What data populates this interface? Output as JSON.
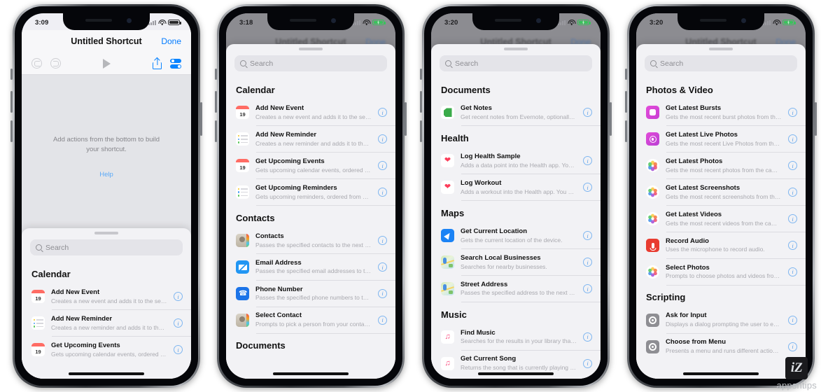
{
  "watermark": {
    "logo": "iZ",
    "text": "appsntips"
  },
  "phones": [
    {
      "id": "phone-editor",
      "status": {
        "time": "3:09",
        "battery_charging": false
      },
      "nav": {
        "title": "Untitled Shortcut",
        "done": "Done"
      },
      "toolbar": {
        "undo": "undo-icon",
        "redo": "redo-icon",
        "play": "play-icon",
        "share": "share-icon",
        "settings": "toggles-icon"
      },
      "canvas": {
        "hint": "Add actions from the bottom to build your shortcut.",
        "help": "Help"
      },
      "search": {
        "placeholder": "Search"
      },
      "sections": [
        {
          "title": "Calendar",
          "items": [
            {
              "title": "Add New Event",
              "subtitle": "Creates a new event and adds it to the sel…",
              "icon": "calendar-19-icon"
            },
            {
              "title": "Add New Reminder",
              "subtitle": "Creates a new reminder and adds it to the…",
              "icon": "reminders-icon"
            },
            {
              "title": "Get Upcoming Events",
              "subtitle": "Gets upcoming calendar events, ordered fr…",
              "icon": "calendar-19-icon"
            }
          ]
        }
      ]
    },
    {
      "id": "phone-calendar-contacts",
      "status": {
        "time": "3:18",
        "battery_charging": true
      },
      "ghost_nav": {
        "title": "Untitled Shortcut",
        "done": "Done"
      },
      "search": {
        "placeholder": "Search"
      },
      "sections": [
        {
          "title": "Calendar",
          "items": [
            {
              "title": "Add New Event",
              "subtitle": "Creates a new event and adds it to the sel…",
              "icon": "calendar-19-icon"
            },
            {
              "title": "Add New Reminder",
              "subtitle": "Creates a new reminder and adds it to the…",
              "icon": "reminders-icon"
            },
            {
              "title": "Get Upcoming Events",
              "subtitle": "Gets upcoming calendar events, ordered fr…",
              "icon": "calendar-19-icon"
            },
            {
              "title": "Get Upcoming Reminders",
              "subtitle": "Gets upcoming reminders, ordered from n…",
              "icon": "reminders-icon"
            }
          ]
        },
        {
          "title": "Contacts",
          "items": [
            {
              "title": "Contacts",
              "subtitle": "Passes the specified contacts to the next a…",
              "icon": "contacts-icon"
            },
            {
              "title": "Email Address",
              "subtitle": "Passes the specified email addresses to th…",
              "icon": "mail-icon"
            },
            {
              "title": "Phone Number",
              "subtitle": "Passes the specified phone numbers to th…",
              "icon": "phone-icon"
            },
            {
              "title": "Select Contact",
              "subtitle": "Prompts to pick a person from your contac…",
              "icon": "contacts-icon"
            }
          ]
        },
        {
          "title": "Documents",
          "items": []
        }
      ]
    },
    {
      "id": "phone-documents-music",
      "status": {
        "time": "3:20",
        "battery_charging": true
      },
      "ghost_nav": {
        "title": "Untitled Shortcut",
        "done": "Done"
      },
      "search": {
        "placeholder": "Search"
      },
      "sections": [
        {
          "title": "Documents",
          "items": [
            {
              "title": "Get Notes",
              "subtitle": "Get recent notes from Evernote, optionally…",
              "icon": "evernote-icon"
            }
          ]
        },
        {
          "title": "Health",
          "items": [
            {
              "title": "Log Health Sample",
              "subtitle": "Adds a data point into the Health app. You…",
              "icon": "health-icon"
            },
            {
              "title": "Log Workout",
              "subtitle": "Adds a workout into the Health app. You ca…",
              "icon": "health-icon"
            }
          ]
        },
        {
          "title": "Maps",
          "items": [
            {
              "title": "Get Current Location",
              "subtitle": "Gets the current location of the device.",
              "icon": "location-arrow-icon"
            },
            {
              "title": "Search Local Businesses",
              "subtitle": "Searches for nearby businesses.",
              "icon": "maps-icon"
            },
            {
              "title": "Street Address",
              "subtitle": "Passes the specified address to the next a…",
              "icon": "maps-icon"
            }
          ]
        },
        {
          "title": "Music",
          "items": [
            {
              "title": "Find Music",
              "subtitle": "Searches for the results in your library that…",
              "icon": "music-note-icon"
            },
            {
              "title": "Get Current Song",
              "subtitle": "Returns the song that is currently playing i…",
              "icon": "music-note-icon"
            }
          ]
        }
      ]
    },
    {
      "id": "phone-photos-scripting",
      "status": {
        "time": "3:20",
        "battery_charging": true
      },
      "ghost_nav": {
        "title": "Untitled Shortcut",
        "done": "Done"
      },
      "search": {
        "placeholder": "Search"
      },
      "sections": [
        {
          "title": "Photos & Video",
          "items": [
            {
              "title": "Get Latest Bursts",
              "subtitle": "Gets the most recent burst photos from th…",
              "icon": "burst-icon"
            },
            {
              "title": "Get Latest Live Photos",
              "subtitle": "Gets the most recent Live Photos from the…",
              "icon": "live-photo-icon"
            },
            {
              "title": "Get Latest Photos",
              "subtitle": "Gets the most recent photos from the cam…",
              "icon": "photos-icon"
            },
            {
              "title": "Get Latest Screenshots",
              "subtitle": "Gets the most recent screenshots from the…",
              "icon": "photos-icon"
            },
            {
              "title": "Get Latest Videos",
              "subtitle": "Gets the most recent videos from the cam…",
              "icon": "photos-icon"
            },
            {
              "title": "Record Audio",
              "subtitle": "Uses the microphone to record audio.",
              "icon": "microphone-icon"
            },
            {
              "title": "Select Photos",
              "subtitle": "Prompts to choose photos and videos fro…",
              "icon": "photos-icon"
            }
          ]
        },
        {
          "title": "Scripting",
          "items": [
            {
              "title": "Ask for Input",
              "subtitle": "Displays a dialog prompting the user to ent…",
              "icon": "scripting-gear-icon"
            },
            {
              "title": "Choose from Menu",
              "subtitle": "Presents a menu and runs different actions…",
              "icon": "scripting-gear-icon"
            }
          ]
        }
      ]
    }
  ]
}
